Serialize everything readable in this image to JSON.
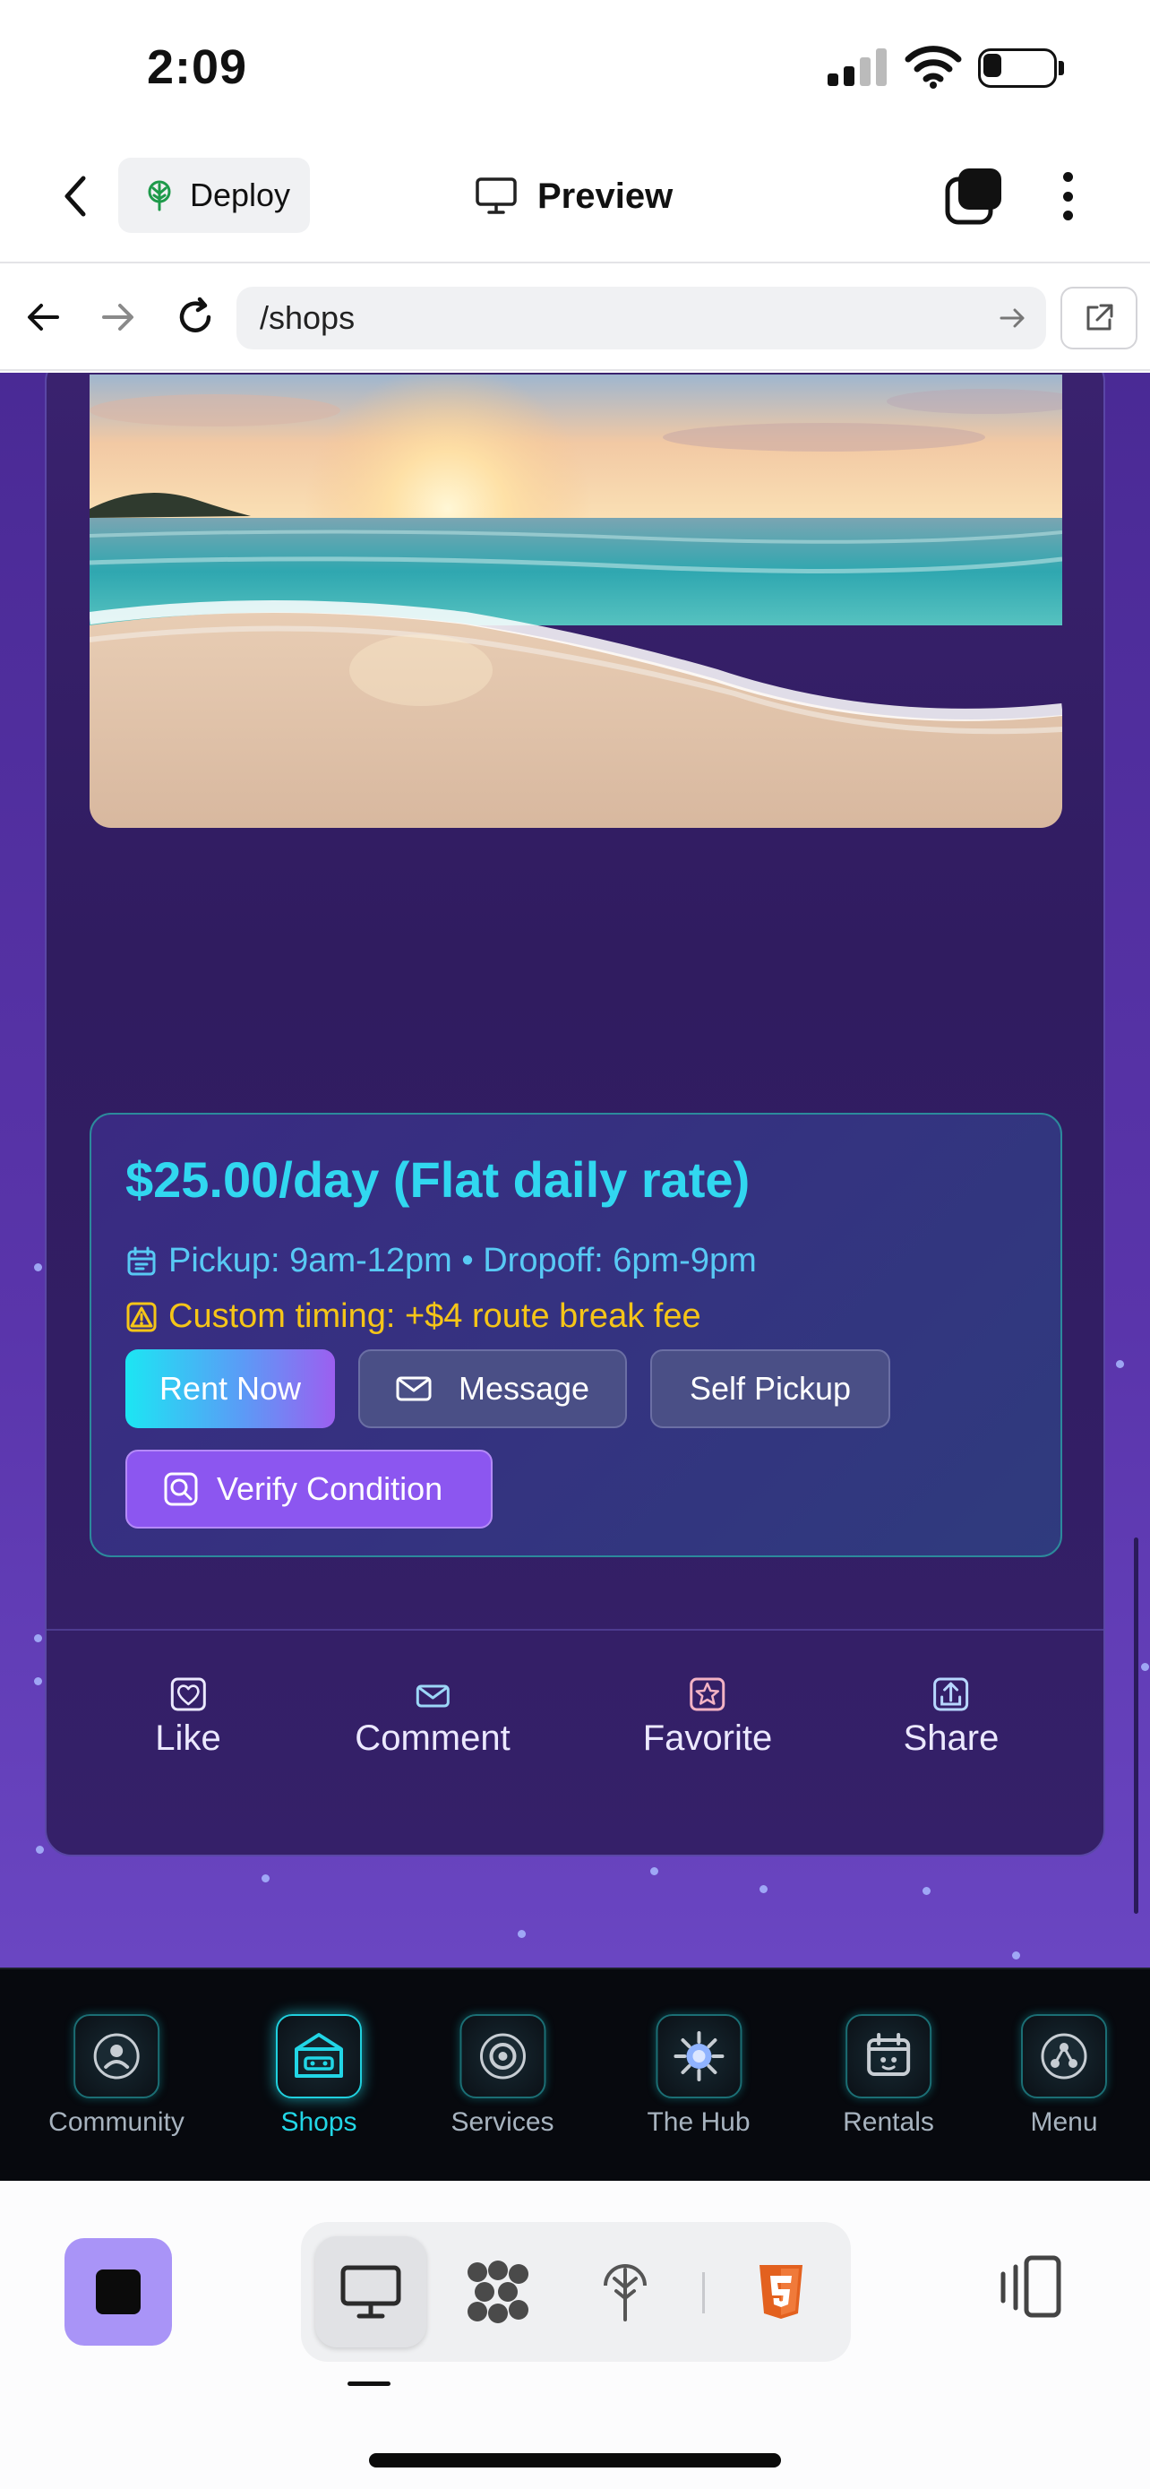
{
  "status_bar": {
    "time": "2:09"
  },
  "app_bar": {
    "deploy_label": "Deploy",
    "title": "Preview"
  },
  "browser": {
    "url": "/shops"
  },
  "rental": {
    "price": "$25.00/day (Flat daily rate)",
    "hours": "Pickup: 9am-12pm • Dropoff: 6pm-9pm",
    "fee": "Custom timing: +$4 route break fee",
    "buttons": {
      "rent_now": "Rent Now",
      "message": "Message",
      "self_pickup": "Self Pickup",
      "verify": "Verify Condition"
    }
  },
  "post_actions": [
    {
      "label": "Like",
      "icon": "heart-icon"
    },
    {
      "label": "Comment",
      "icon": "mail-icon"
    },
    {
      "label": "Favorite",
      "icon": "star-icon"
    },
    {
      "label": "Share",
      "icon": "share-icon"
    }
  ],
  "tab_bar": [
    {
      "label": "Community",
      "icon": "community-icon"
    },
    {
      "label": "Shops",
      "icon": "shop-icon",
      "active": true
    },
    {
      "label": "Services",
      "icon": "services-icon"
    },
    {
      "label": "The Hub",
      "icon": "hub-icon"
    },
    {
      "label": "Rentals",
      "icon": "rentals-icon"
    },
    {
      "label": "Menu",
      "icon": "menu-icon"
    }
  ],
  "colors": {
    "accent_cyan": "#31d7f0",
    "fee_yellow": "#f5c518",
    "verify_purple": "#8c56f0",
    "stop_button": "#a994f7"
  },
  "editor_bar": {
    "modes": [
      "desktop-preview-icon",
      "bubbles-icon",
      "deploy-tree-icon",
      "html5-icon"
    ],
    "active_mode": "desktop-preview-icon"
  }
}
